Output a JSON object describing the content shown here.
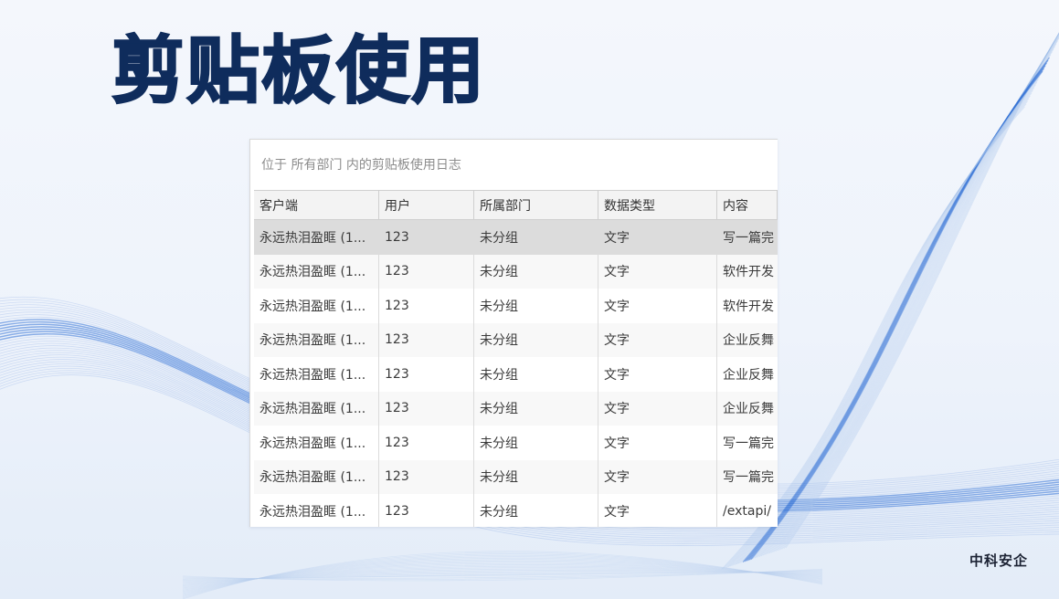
{
  "slide": {
    "title": "剪贴板使用",
    "brand": "中科安企"
  },
  "panel": {
    "caption": "位于 所有部门 内的剪贴板使用日志",
    "columns": [
      "客户端",
      "用户",
      "所属部门",
      "数据类型",
      "内容"
    ],
    "selected_row": 0,
    "rows": [
      [
        "永远热泪盈眶 (1...",
        "123",
        "未分组",
        "文字",
        "写一篇完"
      ],
      [
        "永远热泪盈眶 (1...",
        "123",
        "未分组",
        "文字",
        "软件开发"
      ],
      [
        "永远热泪盈眶 (1...",
        "123",
        "未分组",
        "文字",
        "软件开发"
      ],
      [
        "永远热泪盈眶 (1...",
        "123",
        "未分组",
        "文字",
        "企业反舞"
      ],
      [
        "永远热泪盈眶 (1...",
        "123",
        "未分组",
        "文字",
        "企业反舞"
      ],
      [
        "永远热泪盈眶 (1...",
        "123",
        "未分组",
        "文字",
        "企业反舞"
      ],
      [
        "永远热泪盈眶 (1...",
        "123",
        "未分组",
        "文字",
        "写一篇完"
      ],
      [
        "永远热泪盈眶 (1...",
        "123",
        "未分组",
        "文字",
        "写一篇完"
      ],
      [
        "永远热泪盈眶 (1...",
        "123",
        "未分组",
        "文字",
        "/extapi/"
      ]
    ]
  },
  "colors": {
    "title": "#0f2c5c",
    "accent_wave": "#2f6fd6",
    "selected_row": "#dcdcdc",
    "header_bg": "#f3f3f3"
  }
}
